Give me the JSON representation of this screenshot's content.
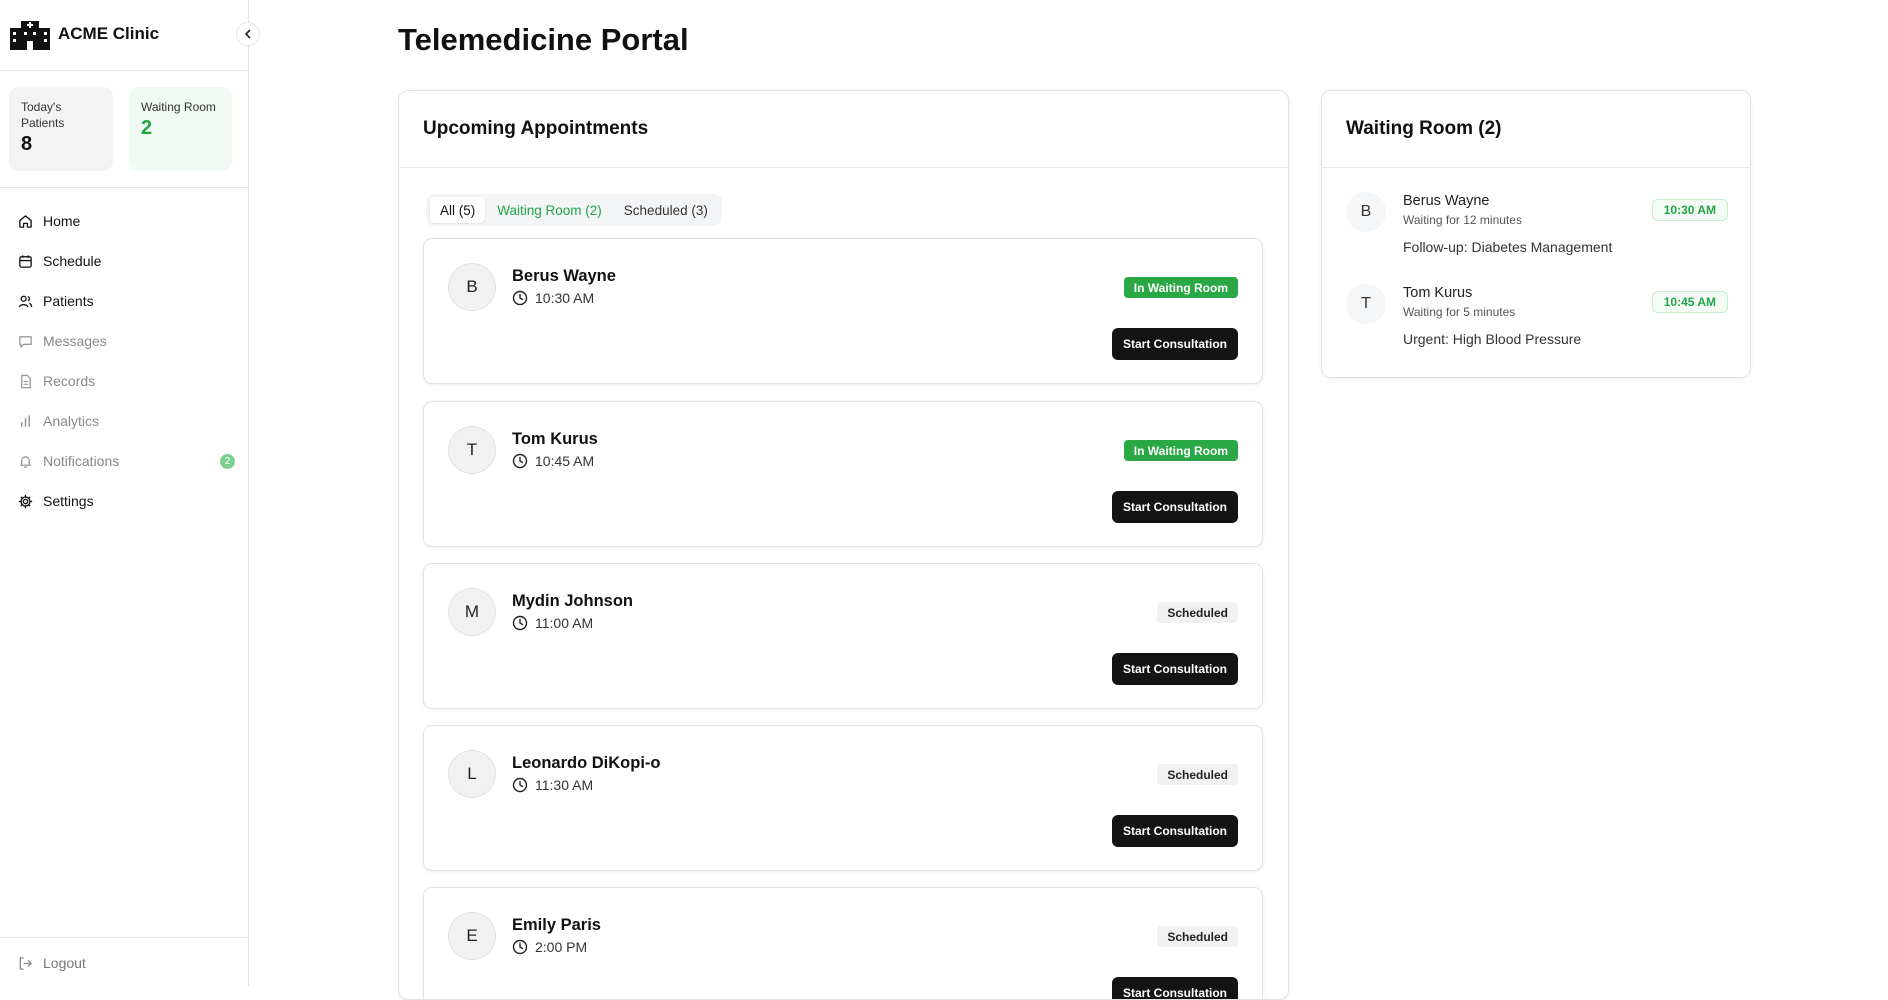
{
  "brand": {
    "name": "ACME Clinic",
    "logo_icon": "hospital-icon"
  },
  "stats": [
    {
      "label": "Today's Patients",
      "value": "8"
    },
    {
      "label": "Waiting Room",
      "value": "2"
    }
  ],
  "nav": [
    {
      "label": "Home",
      "icon": "home-icon",
      "enabled": true
    },
    {
      "label": "Schedule",
      "icon": "calendar-icon",
      "enabled": true
    },
    {
      "label": "Patients",
      "icon": "users-icon",
      "enabled": true
    },
    {
      "label": "Messages",
      "icon": "message-icon",
      "enabled": false
    },
    {
      "label": "Records",
      "icon": "document-icon",
      "enabled": false
    },
    {
      "label": "Analytics",
      "icon": "bar-chart-icon",
      "enabled": false
    },
    {
      "label": "Notifications",
      "icon": "bell-icon",
      "enabled": false,
      "badge": "2"
    },
    {
      "label": "Settings",
      "icon": "gear-icon",
      "enabled": true
    }
  ],
  "logout": {
    "label": "Logout"
  },
  "page": {
    "title": "Telemedicine Portal"
  },
  "appointments": {
    "title": "Upcoming Appointments",
    "tabs": [
      "All (5)",
      "Waiting Room (2)",
      "Scheduled (3)"
    ],
    "start_label": "Start Consultation",
    "items": [
      {
        "initial": "B",
        "name": "Berus Wayne",
        "time": "10:30 AM",
        "status": "In Waiting Room"
      },
      {
        "initial": "T",
        "name": "Tom Kurus",
        "time": "10:45 AM",
        "status": "In Waiting Room"
      },
      {
        "initial": "M",
        "name": "Mydin Johnson",
        "time": "11:00 AM",
        "status": "Scheduled"
      },
      {
        "initial": "L",
        "name": "Leonardo DiKopi-o",
        "time": "11:30 AM",
        "status": "Scheduled"
      },
      {
        "initial": "E",
        "name": "Emily Paris",
        "time": "2:00 PM",
        "status": "Scheduled"
      }
    ]
  },
  "waiting_room": {
    "title": "Waiting Room (2)",
    "items": [
      {
        "initial": "B",
        "name": "Berus Wayne",
        "wait": "Waiting for 12 minutes",
        "reason": "Follow-up: Diabetes Management",
        "time": "10:30 AM"
      },
      {
        "initial": "T",
        "name": "Tom Kurus",
        "wait": "Waiting for 5 minutes",
        "reason": "Urgent: High Blood Pressure",
        "time": "10:45 AM"
      }
    ]
  },
  "colors": {
    "accent_green": "#22a447",
    "dark_button": "#141414"
  }
}
